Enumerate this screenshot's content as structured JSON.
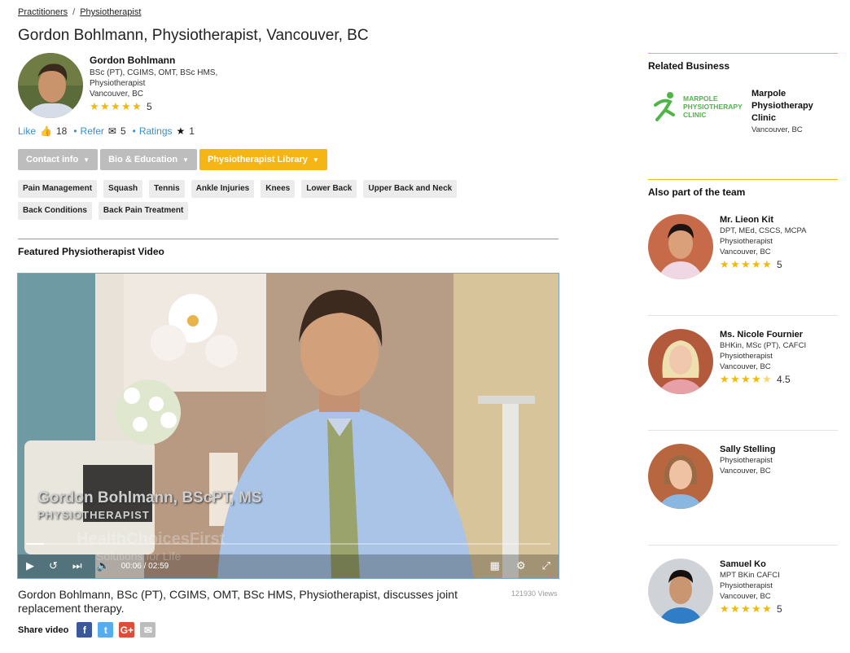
{
  "breadcrumb": {
    "items": [
      "Practitioners",
      "Physiotherapist"
    ],
    "separator": "/"
  },
  "title": "Gordon Bohlmann, Physiotherapist, Vancouver, BC",
  "profile": {
    "name": "Gordon Bohlmann",
    "credentials_1": "BSc (PT), CGIMS, OMT, BSc HMS,",
    "credentials_2": "Physiotherapist",
    "location": "Vancouver, BC",
    "rating": "5"
  },
  "social": {
    "like_label": "Like",
    "like_count": "18",
    "refer_label": "Refer",
    "refer_count": "5",
    "ratings_label": "Ratings",
    "ratings_count": "1"
  },
  "buttons": {
    "contact": "Contact info",
    "bio": "Bio & Education",
    "library": "Physiotherapist Library"
  },
  "tags": [
    "Pain Management",
    "Squash",
    "Tennis",
    "Ankle Injuries",
    "Knees",
    "Lower Back",
    "Upper Back and Neck",
    "Back Conditions",
    "Back Pain Treatment"
  ],
  "featured": {
    "heading": "Featured Physiotherapist Video",
    "overlay_name": "Gordon Bohlmann, BScPT, MS",
    "overlay_role": "PHYSIOTHERAPIST",
    "watermark_1": "HealthChoicesFirst",
    "watermark_2": "Solutions for Life",
    "time_current": "00:06",
    "time_total": "02:59",
    "progress": 0.034,
    "description": "Gordon Bohlmann, BSc (PT), CGIMS, OMT, BSc HMS, Physiotherapist, discusses joint replacement therapy.",
    "views": "121930 Views"
  },
  "share": {
    "label": "Share video",
    "buttons": [
      {
        "name": "facebook-share-button",
        "glyph": "f",
        "color": "#3b5998"
      },
      {
        "name": "twitter-share-button",
        "glyph": "t",
        "color": "#55acee"
      },
      {
        "name": "googleplus-share-button",
        "glyph": "G+",
        "color": "#dd4b39"
      },
      {
        "name": "email-share-button",
        "glyph": "✉",
        "color": "#bdbdbd"
      }
    ]
  },
  "related": {
    "heading": "Related Business",
    "logo_line_1": "MARPOLE",
    "logo_line_2": "PHYSIOTHERAPY",
    "logo_line_3": "CLINIC",
    "name": "Marpole Physiotherapy Clinic",
    "location": "Vancouver, BC"
  },
  "team": {
    "heading": "Also part of the team",
    "members": [
      {
        "name": "Mr. Lieon Kit",
        "creds": "DPT, MEd, CSCS, MCPA",
        "role": "Physiotherapist",
        "location": "Vancouver, BC",
        "rating": "5"
      },
      {
        "name": "Ms. Nicole Fournier",
        "creds": "BHKin, MSc (PT), CAFCI",
        "role": "Physiotherapist",
        "location": "Vancouver, BC",
        "rating": "4.5"
      },
      {
        "name": "Sally Stelling",
        "creds": "",
        "role": "Physiotherapist",
        "location": "Vancouver, BC",
        "rating": ""
      },
      {
        "name": "Samuel Ko",
        "creds": "MPT BKin CAFCI",
        "role": "Physiotherapist",
        "location": "Vancouver, BC",
        "rating": "5"
      }
    ]
  },
  "colors": {
    "accent": "#f5b515",
    "link": "#3a8fc6",
    "star": "#f0b90b"
  }
}
